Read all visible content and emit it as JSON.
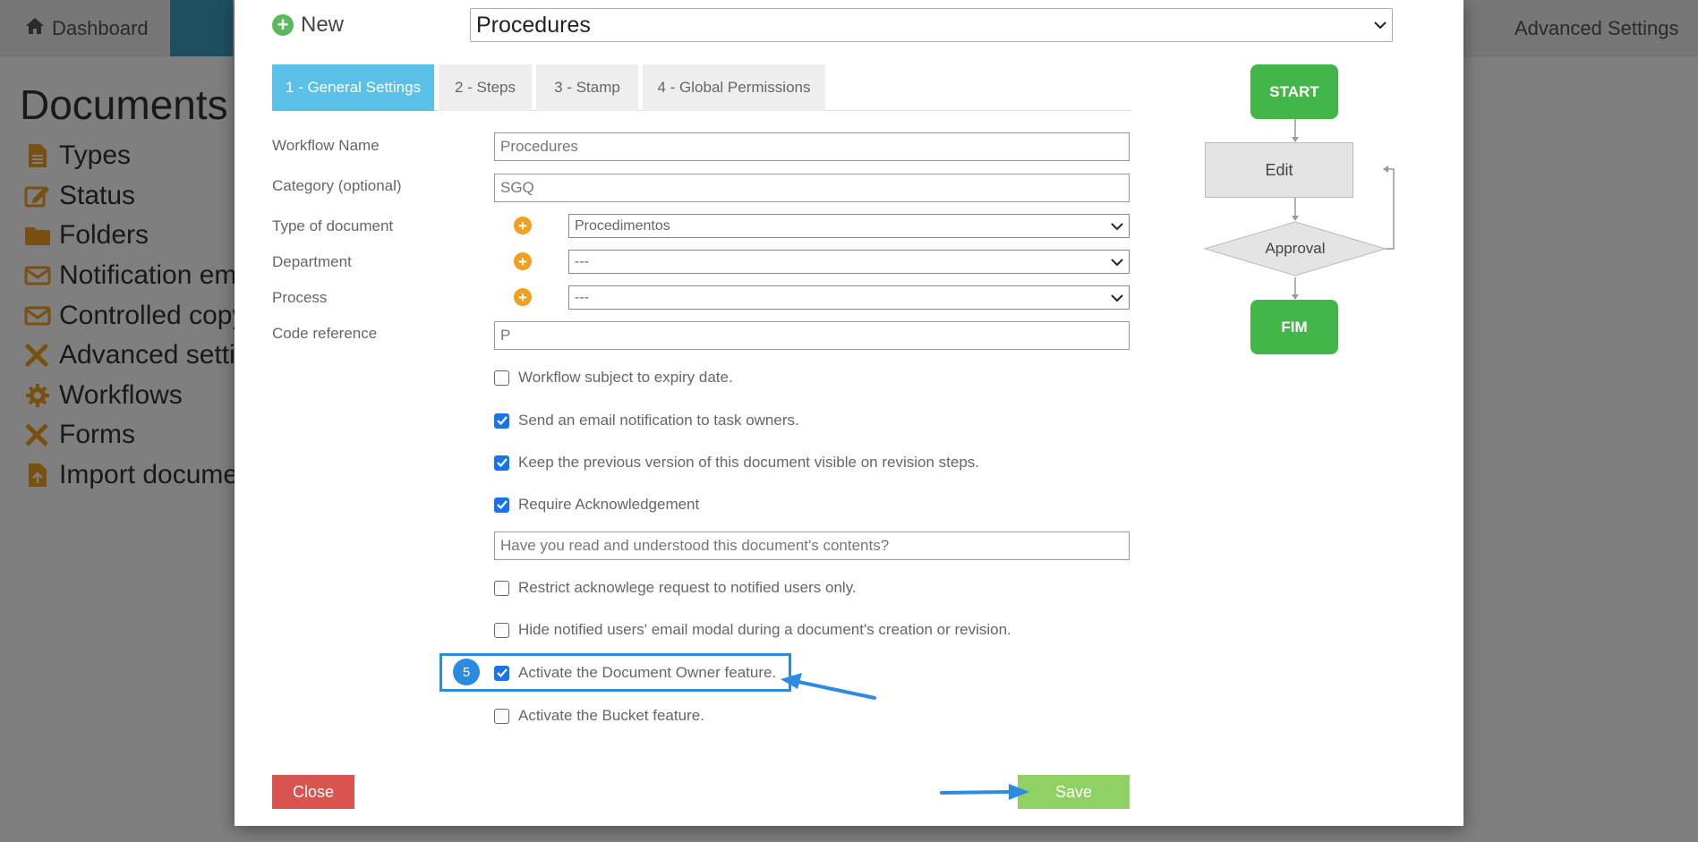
{
  "background": {
    "nav": {
      "dashboard": "Dashboard",
      "advanced_settings": "Advanced Settings"
    },
    "heading": "Documents",
    "menu": [
      {
        "label": "Types",
        "icon": "file-icon"
      },
      {
        "label": "Status",
        "icon": "edit-icon"
      },
      {
        "label": "Folders",
        "icon": "folder-icon"
      },
      {
        "label": "Notification em",
        "icon": "envelope-icon"
      },
      {
        "label": "Controlled copy",
        "icon": "envelope-icon"
      },
      {
        "label": "Advanced setti",
        "icon": "tools-icon"
      },
      {
        "label": "Workflows",
        "icon": "gear-icon"
      },
      {
        "label": "Forms",
        "icon": "ruler-pencil-icon"
      },
      {
        "label": "Import docume",
        "icon": "file-upload-icon"
      }
    ]
  },
  "modal": {
    "new_label": "New",
    "title_select": "Procedures",
    "tabs": [
      {
        "label": "1 - General Settings",
        "active": true
      },
      {
        "label": "2 - Steps",
        "active": false
      },
      {
        "label": "3 - Stamp",
        "active": false
      },
      {
        "label": "4 - Global Permissions",
        "active": false
      }
    ],
    "fields": {
      "workflow_name": {
        "label": "Workflow Name",
        "value": "Procedures"
      },
      "category": {
        "label": "Category (optional)",
        "value": "SGQ"
      },
      "doc_type": {
        "label": "Type of document",
        "value": "Procedimentos"
      },
      "department": {
        "label": "Department",
        "value": "---"
      },
      "process": {
        "label": "Process",
        "value": "---"
      },
      "code_reference": {
        "label": "Code reference",
        "value": "P"
      },
      "ack_question": {
        "value": "Have you read and understood this document's contents?"
      }
    },
    "checkboxes": [
      {
        "label": "Workflow subject to expiry date.",
        "checked": false
      },
      {
        "label": "Send an email notification to task owners.",
        "checked": true
      },
      {
        "label": "Keep the previous version of this document visible on revision steps.",
        "checked": true
      },
      {
        "label": "Require Acknowledgement",
        "checked": true
      },
      {
        "label": "Restrict acknowlege request to notified users only.",
        "checked": false
      },
      {
        "label": "Hide notified users' email modal during a document's creation or revision.",
        "checked": false
      },
      {
        "label": "Activate the Document Owner feature.",
        "checked": true
      },
      {
        "label": "Activate the Bucket feature.",
        "checked": false
      }
    ],
    "step_badge": "5",
    "buttons": {
      "close": "Close",
      "save": "Save"
    },
    "flowchart": {
      "start": "START",
      "edit": "Edit",
      "approval": "Approval",
      "end": "FIM"
    }
  },
  "colors": {
    "accent": "#5bc0e8",
    "check": "#1a73e8",
    "annotation": "#2b8be0",
    "close": "#d9534f",
    "save": "#8fd163",
    "flow_green": "#43b649",
    "plus_orange": "#f0a020"
  }
}
